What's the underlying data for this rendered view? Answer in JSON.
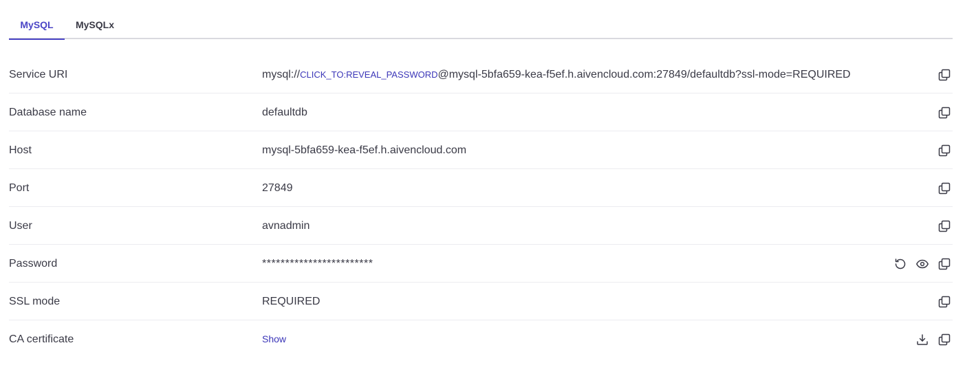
{
  "tabs": [
    {
      "label": "MySQL",
      "active": true
    },
    {
      "label": "MySQLx",
      "active": false
    }
  ],
  "rows": {
    "service_uri": {
      "label": "Service URI",
      "prefix": "mysql://",
      "reveal": "CLICK_TO:REVEAL_PASSWORD",
      "suffix": "@mysql-5bfa659-kea-f5ef.h.aivencloud.com:27849/defaultdb?ssl-mode=REQUIRED"
    },
    "database_name": {
      "label": "Database name",
      "value": "defaultdb"
    },
    "host": {
      "label": "Host",
      "value": "mysql-5bfa659-kea-f5ef.h.aivencloud.com"
    },
    "port": {
      "label": "Port",
      "value": "27849"
    },
    "user": {
      "label": "User",
      "value": "avnadmin"
    },
    "password": {
      "label": "Password",
      "value": "************************"
    },
    "ssl_mode": {
      "label": "SSL mode",
      "value": "REQUIRED"
    },
    "ca_certificate": {
      "label": "CA certificate",
      "value": "Show"
    }
  },
  "icons": {
    "copy": "copy-icon",
    "reset": "reset-icon",
    "reveal": "eye-icon",
    "download": "download-icon"
  },
  "colors": {
    "accent": "#4b45c6",
    "link": "#3b36b8",
    "text": "#3a3a46",
    "divider": "#ececf0"
  }
}
